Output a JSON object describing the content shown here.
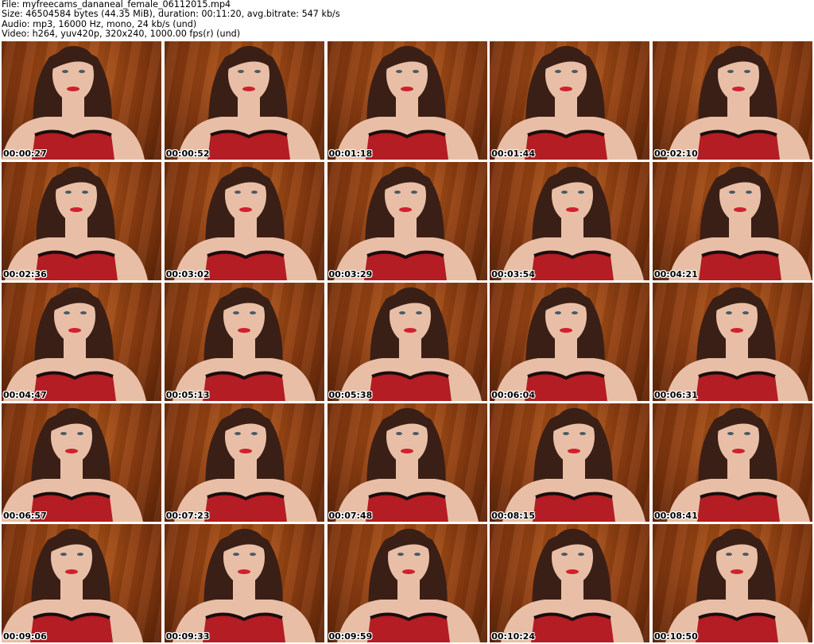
{
  "header": {
    "line1": "File: myfreecams_dananeal_female_06112015.mp4",
    "line2": "Size: 46504584 bytes (44.35 MiB), duration: 00:11:20, avg.bitrate: 547 kb/s",
    "line3": "Audio: mp3, 16000 Hz, mono, 24 kb/s (und)",
    "line4": "Video: h264, yuv420p, 320x240, 1000.00 fps(r) (und)"
  },
  "thumbnails": [
    {
      "time": "00:00:27"
    },
    {
      "time": "00:00:52"
    },
    {
      "time": "00:01:18"
    },
    {
      "time": "00:01:44"
    },
    {
      "time": "00:02:10"
    },
    {
      "time": "00:02:36"
    },
    {
      "time": "00:03:02"
    },
    {
      "time": "00:03:29"
    },
    {
      "time": "00:03:54"
    },
    {
      "time": "00:04:21"
    },
    {
      "time": "00:04:47"
    },
    {
      "time": "00:05:13"
    },
    {
      "time": "00:05:38"
    },
    {
      "time": "00:06:04"
    },
    {
      "time": "00:06:31"
    },
    {
      "time": "00:06:57"
    },
    {
      "time": "00:07:23"
    },
    {
      "time": "00:07:48"
    },
    {
      "time": "00:08:15"
    },
    {
      "time": "00:08:41"
    },
    {
      "time": "00:09:06"
    },
    {
      "time": "00:09:33"
    },
    {
      "time": "00:09:59"
    },
    {
      "time": "00:10:24"
    },
    {
      "time": "00:10:50"
    }
  ],
  "colors": {
    "wall": "#8a3b10",
    "skin": "#e8bfa6",
    "hair": "#3a1f16",
    "top": "#b31d23",
    "lace": "#1a0d0d"
  }
}
